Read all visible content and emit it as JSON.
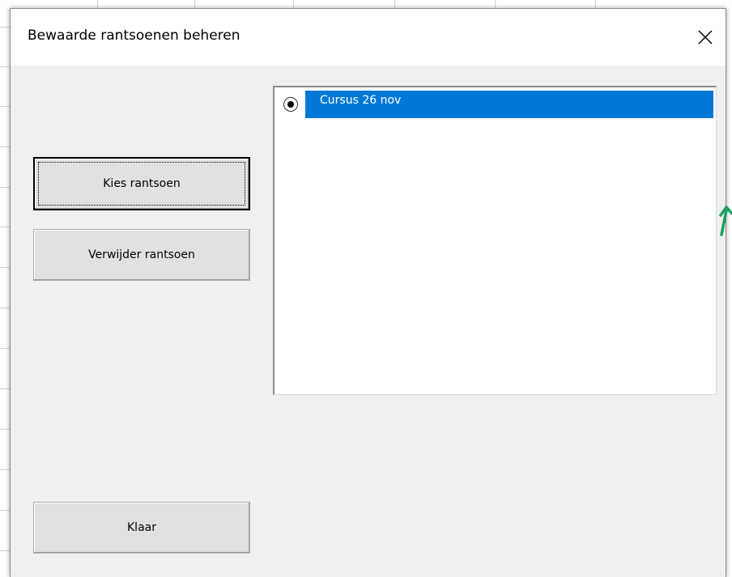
{
  "dialog": {
    "title": "Bewaarde rantsoenen beheren",
    "close_icon": "close-icon"
  },
  "buttons": {
    "choose_label": "Kies rantsoen",
    "delete_label": "Verwijder rantsoen",
    "done_label": "Klaar"
  },
  "rations_list": {
    "items": [
      {
        "label": "Cursus 26 nov",
        "selected": true
      }
    ]
  },
  "colors": {
    "selection": "#0078d7",
    "dialog_bg": "#f0f0f0",
    "annotation_arrow": "#1aa060"
  }
}
